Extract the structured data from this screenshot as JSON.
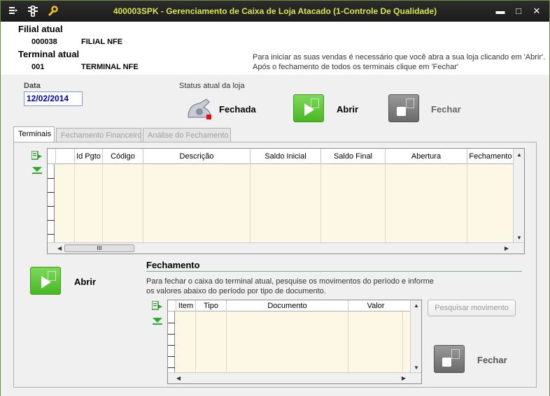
{
  "window": {
    "title": "400003SPK - Gerenciamento de Caixa de Loja Atacado (1-Controle De Qualidade)",
    "title_color": "#d8e84a",
    "icons": [
      "menu-icon",
      "traffic-light-icon",
      "wrench-icon"
    ],
    "controls": {
      "minimize": "▬",
      "maximize": "□",
      "close": "✕"
    }
  },
  "header": {
    "filial_label": "Filial atual",
    "filial_code": "000038",
    "filial_name": "FILIAL NFE",
    "terminal_label": "Terminal atual",
    "terminal_code": "001",
    "terminal_name": "TERMINAL NFE",
    "info_line1": "Para iniciar as suas vendas é necessário que você abra a sua loja clicando em 'Abrir'.",
    "info_line2": "Após o fechamento de todos os terminais clique em 'Fechar'"
  },
  "date": {
    "label": "Data",
    "value": "12/02/2014"
  },
  "status": {
    "label": "Status atual da loja",
    "value": "Fechada",
    "open_label": "Abrir",
    "close_label": "Fechar"
  },
  "tabs": [
    {
      "label": "Terminais",
      "active": true
    },
    {
      "label": "Fechamento Financeiro",
      "active": false
    },
    {
      "label": "Análise do Fechamento",
      "active": false
    }
  ],
  "terminais_grid": {
    "columns": [
      "Id Pgto",
      "Código",
      "Descrição",
      "Saldo Inicial",
      "Saldo Final",
      "Abertura",
      "Fechamento"
    ],
    "rows": [],
    "hscroll_thumb": "III"
  },
  "terminal_actions": {
    "open_label": "Abrir"
  },
  "fechamento": {
    "title": "Fechamento",
    "description": "Para fechar o caixa do terminal atual, pesquise os movimentos do período e informe os valores abaixo do período por tipo de documento.",
    "grid_columns": [
      "Item",
      "Tipo",
      "Documento",
      "Valor"
    ],
    "rows": [],
    "search_button": "Pesquisar movimento",
    "close_label": "Fechar"
  },
  "colors": {
    "green_button": "#48b824",
    "gray_button": "#6a6a6a",
    "grid_background": "#fdf7e6",
    "date_text": "#0000aa"
  }
}
